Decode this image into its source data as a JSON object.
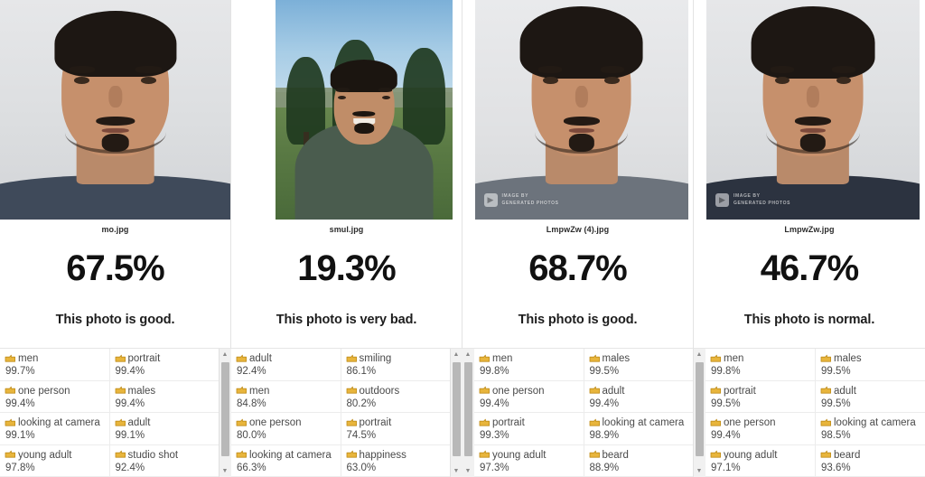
{
  "app": {
    "watermark_line1": "IMAGE BY",
    "watermark_line2": "GENERATED PHOTOS",
    "watermark_icon": "play-badge-icon",
    "tag_icon": "tag-icon",
    "scroll_up_icon": "▲",
    "scroll_down_icon": "▼"
  },
  "panels": [
    {
      "filename": "mo.jpg",
      "score": "67.5%",
      "verdict": "This photo is good.",
      "has_watermark": false,
      "photo_type": "studio-portrait",
      "tags_left": [
        {
          "label": "men",
          "score": "99.7%"
        },
        {
          "label": "one person",
          "score": "99.4%"
        },
        {
          "label": "looking at camera",
          "score": "99.1%"
        },
        {
          "label": "young adult",
          "score": "97.8%"
        }
      ],
      "tags_right": [
        {
          "label": "portrait",
          "score": "99.4%"
        },
        {
          "label": "males",
          "score": "99.4%"
        },
        {
          "label": "adult",
          "score": "99.1%"
        },
        {
          "label": "studio shot",
          "score": "92.4%"
        }
      ]
    },
    {
      "filename": "smul.jpg",
      "score": "19.3%",
      "verdict": "This photo is very bad.",
      "has_watermark": false,
      "photo_type": "outdoor-selfie",
      "tags_left": [
        {
          "label": "adult",
          "score": "92.4%"
        },
        {
          "label": "men",
          "score": "84.8%"
        },
        {
          "label": "one person",
          "score": "80.0%"
        },
        {
          "label": "looking at camera",
          "score": "66.3%"
        }
      ],
      "tags_right": [
        {
          "label": "smiling",
          "score": "86.1%"
        },
        {
          "label": "outdoors",
          "score": "80.2%"
        },
        {
          "label": "portrait",
          "score": "74.5%"
        },
        {
          "label": "happiness",
          "score": "63.0%"
        }
      ]
    },
    {
      "filename": "LmpwZw (4).jpg",
      "score": "68.7%",
      "verdict": "This photo is good.",
      "has_watermark": true,
      "photo_type": "studio-portrait",
      "tags_left": [
        {
          "label": "men",
          "score": "99.8%"
        },
        {
          "label": "one person",
          "score": "99.4%"
        },
        {
          "label": "portrait",
          "score": "99.3%"
        },
        {
          "label": "young adult",
          "score": "97.3%"
        }
      ],
      "tags_right": [
        {
          "label": "males",
          "score": "99.5%"
        },
        {
          "label": "adult",
          "score": "99.4%"
        },
        {
          "label": "looking at camera",
          "score": "98.9%"
        },
        {
          "label": "beard",
          "score": "88.9%"
        }
      ]
    },
    {
      "filename": "LmpwZw.jpg",
      "score": "46.7%",
      "verdict": "This photo is normal.",
      "has_watermark": true,
      "photo_type": "studio-portrait",
      "tags_left": [
        {
          "label": "men",
          "score": "99.8%"
        },
        {
          "label": "portrait",
          "score": "99.5%"
        },
        {
          "label": "one person",
          "score": "99.4%"
        },
        {
          "label": "young adult",
          "score": "97.1%"
        }
      ],
      "tags_right": [
        {
          "label": "males",
          "score": "99.5%"
        },
        {
          "label": "adult",
          "score": "99.5%"
        },
        {
          "label": "looking at camera",
          "score": "98.5%"
        },
        {
          "label": "beard",
          "score": "93.6%"
        }
      ]
    }
  ]
}
